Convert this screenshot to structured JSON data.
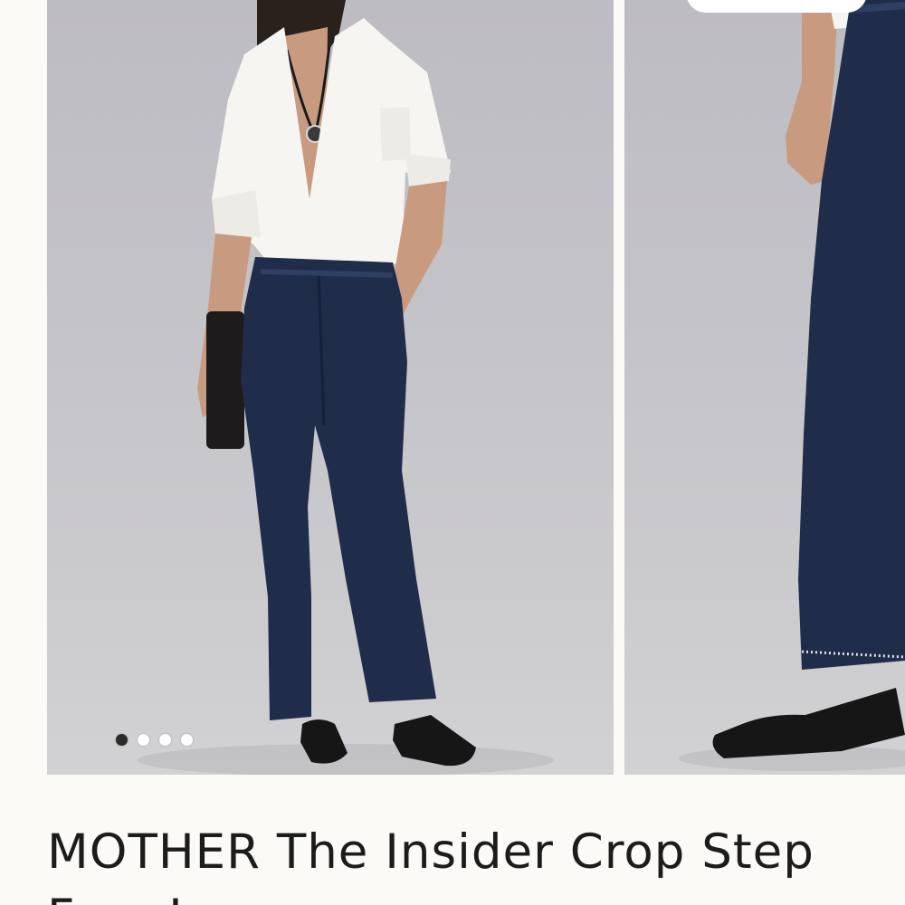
{
  "product": {
    "title": "MOTHER The Insider Crop Step Fray Jeans"
  },
  "carousel": {
    "slide_count": 4,
    "active_index": 0,
    "images": [
      {
        "name": "model-front-view"
      },
      {
        "name": "model-side-view"
      }
    ]
  },
  "colors": {
    "background": "#fbfaf7",
    "photo_backdrop": "#c4c3c8",
    "denim": "#1f2c4a",
    "shirt": "#f6f5f1",
    "dot_active": "#2b2b2b",
    "dot_inactive": "#ffffff"
  }
}
